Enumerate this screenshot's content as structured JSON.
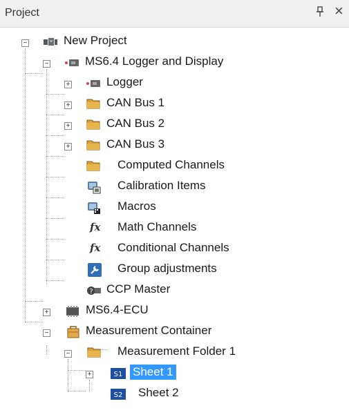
{
  "panel": {
    "title": "Project",
    "pin_glyph": "↑",
    "close_glyph": "×"
  },
  "tree": {
    "root": "New Project",
    "logger_display": "MS6.4 Logger and Display",
    "logger": "Logger",
    "can1": "CAN Bus 1",
    "can2": "CAN Bus 2",
    "can3": "CAN Bus 3",
    "computed": "Computed Channels",
    "calibration": "Calibration Items",
    "macros": "Macros",
    "math": "Math Channels",
    "conditional": "Conditional Channels",
    "group": "Group adjustments",
    "ccp": "CCP Master",
    "ecu": "MS6.4-ECU",
    "container": "Measurement Container",
    "folder1": "Measurement Folder 1",
    "sheet1": "Sheet 1",
    "sheet2": "Sheet 2",
    "fx": "fx",
    "sheet1_badge": "S1",
    "sheet2_badge": "S2"
  },
  "colors": {
    "selection": "#3399ff",
    "folder": "#d9a23b",
    "sheet_icon": "#1f4fa3"
  },
  "icons": [
    "pin-icon",
    "close-icon",
    "project-icon",
    "logger-device-icon",
    "folder-icon",
    "calibration-icon",
    "macros-icon",
    "fx-icon",
    "wrench-icon",
    "ccp-icon",
    "ecu-icon",
    "container-icon",
    "sheet-icon"
  ]
}
